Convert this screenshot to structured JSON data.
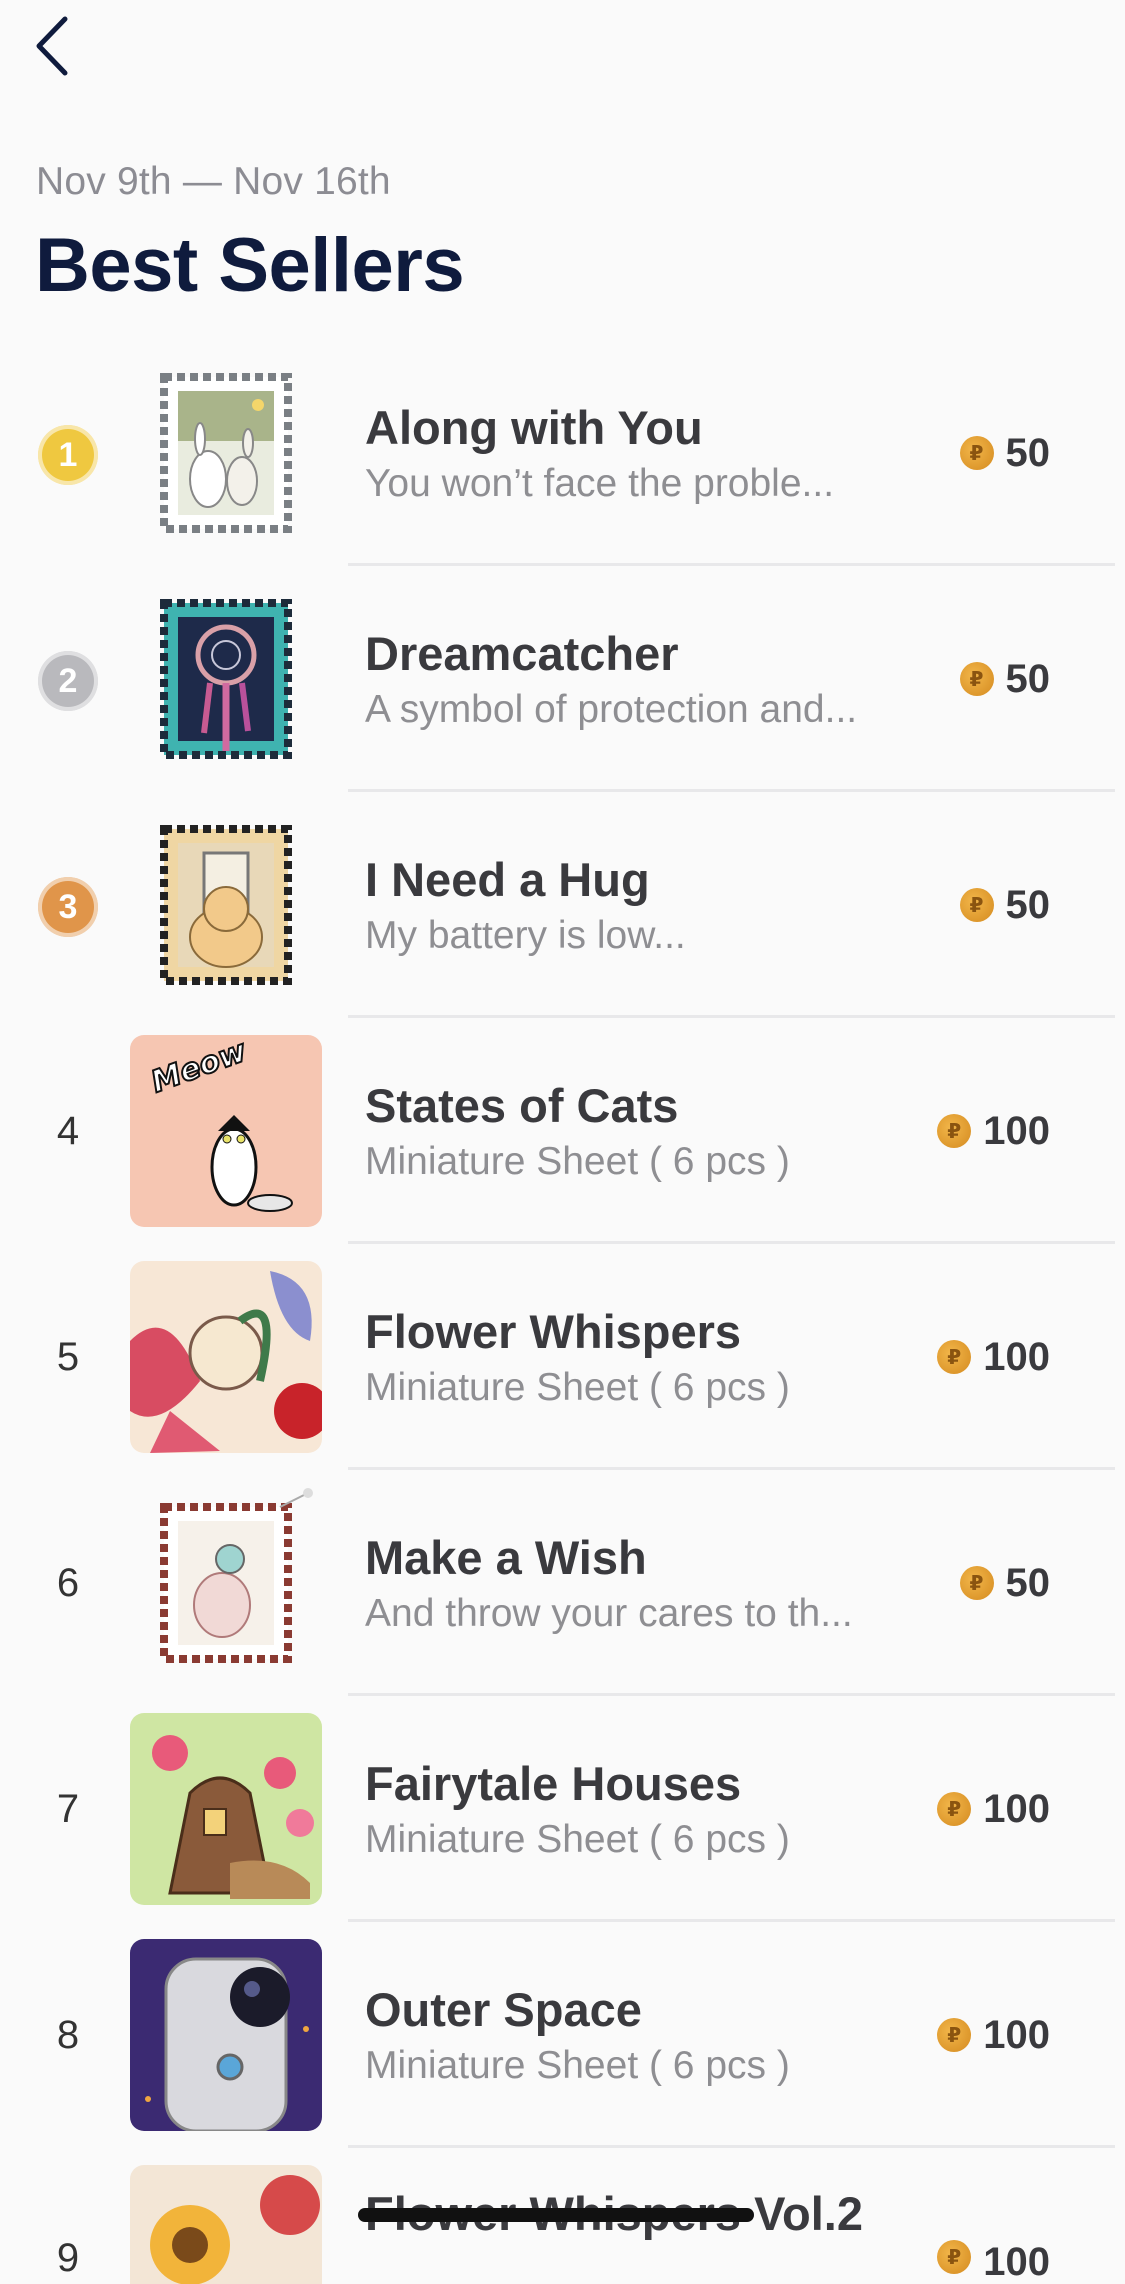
{
  "header": {
    "date_range": "Nov 9th — Nov 16th",
    "title": "Best Sellers",
    "back_icon": "chevron-left-icon"
  },
  "items": [
    {
      "rank": "1",
      "medal": "gold",
      "title": "Along with You",
      "subtitle": "You won’t face the proble...",
      "price": "50",
      "thumb": "stamp-bunnies"
    },
    {
      "rank": "2",
      "medal": "silver",
      "title": "Dreamcatcher",
      "subtitle": "A symbol of protection and...",
      "price": "50",
      "thumb": "stamp-dreamcatcher"
    },
    {
      "rank": "3",
      "medal": "bronze",
      "title": "I Need a Hug",
      "subtitle": "My battery is low...",
      "price": "50",
      "thumb": "stamp-cat"
    },
    {
      "rank": "4",
      "title": "States of Cats",
      "subtitle": "Miniature Sheet ( 6 pcs )",
      "price": "100",
      "thumb": "sheet-cats",
      "thumb_text": "Meow"
    },
    {
      "rank": "5",
      "title": "Flower Whispers",
      "subtitle": "Miniature Sheet ( 6 pcs )",
      "price": "100",
      "thumb": "sheet-flowers"
    },
    {
      "rank": "6",
      "title": "Make a Wish",
      "subtitle": "And throw your cares to th...",
      "price": "50",
      "thumb": "stamp-mouse"
    },
    {
      "rank": "7",
      "title": "Fairytale Houses",
      "subtitle": "Miniature Sheet ( 6 pcs )",
      "price": "100",
      "thumb": "sheet-houses"
    },
    {
      "rank": "8",
      "title": "Outer Space",
      "subtitle": "Miniature Sheet ( 6 pcs )",
      "price": "100",
      "thumb": "sheet-space"
    },
    {
      "rank": "9",
      "title": "Flower Whispers Vol.2",
      "subtitle": "",
      "price": "100",
      "thumb": "sheet-sunflower"
    }
  ],
  "colors": {
    "title": "#0f1b3d",
    "gold": "#efc840",
    "silver": "#b9b9bd",
    "bronze": "#e0954a",
    "coin": "#e1a236"
  }
}
